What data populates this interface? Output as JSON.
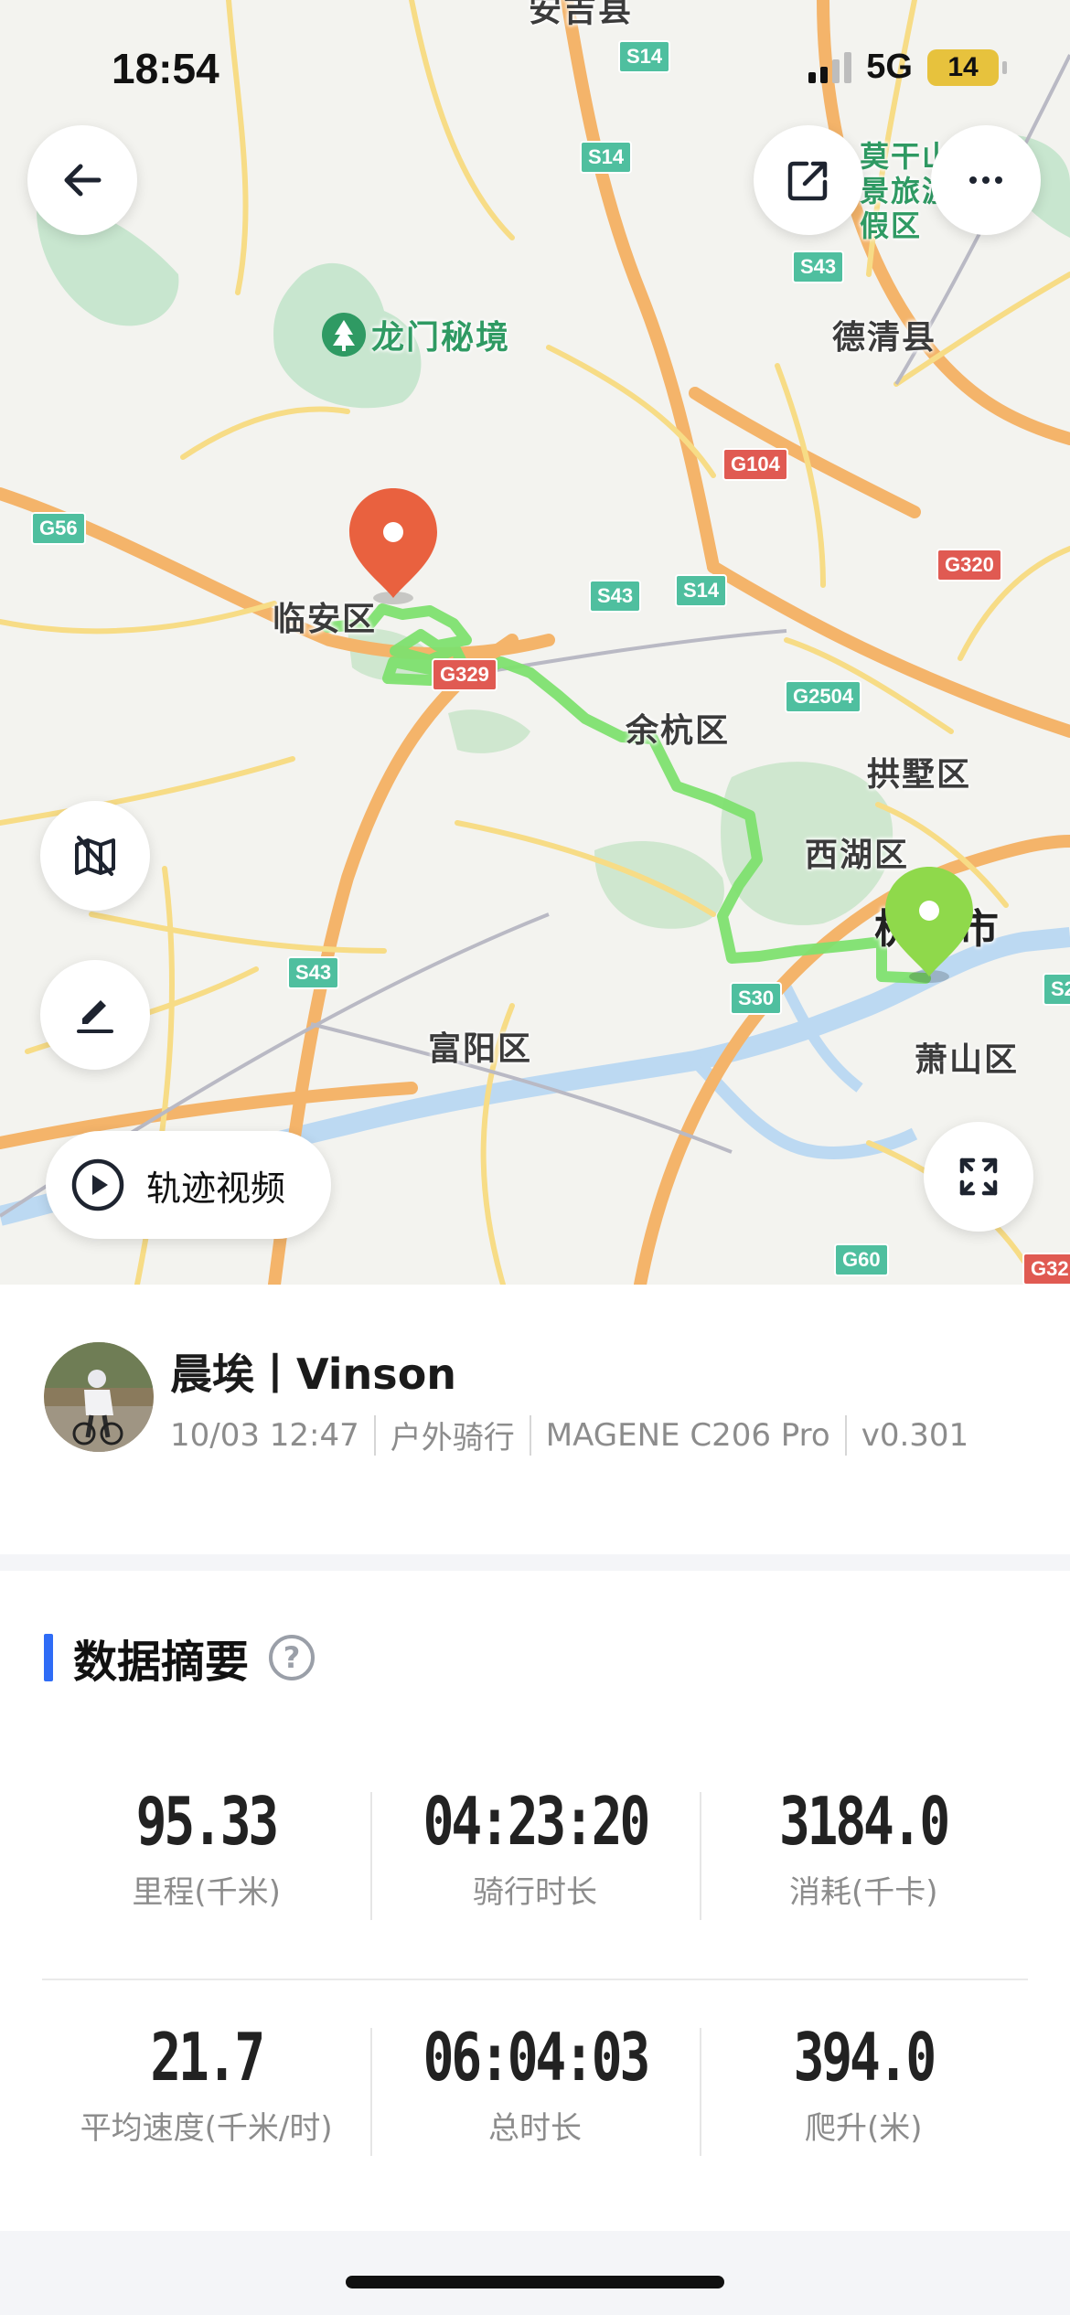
{
  "status_bar": {
    "time": "18:54",
    "network": "5G",
    "battery": "14"
  },
  "map": {
    "place_labels": [
      {
        "id": "top-cut",
        "text": "安吉县"
      },
      {
        "id": "longmen",
        "text": "龙门秘境"
      },
      {
        "id": "deqing",
        "text": "德清县"
      },
      {
        "id": "linan",
        "text": "临安区"
      },
      {
        "id": "yuhang",
        "text": "余杭区"
      },
      {
        "id": "gongshu",
        "text": "拱墅区"
      },
      {
        "id": "xihu",
        "text": "西湖区"
      },
      {
        "id": "city",
        "text": "杭州市"
      },
      {
        "id": "xiaoshan",
        "text": "萧山区"
      },
      {
        "id": "fuyang",
        "text": "富阳区"
      },
      {
        "id": "moganshan",
        "text": "莫干山风景旅游度假区"
      }
    ],
    "road_shields": [
      {
        "id": "s14a",
        "text": "S14"
      },
      {
        "id": "s14b",
        "text": "S14"
      },
      {
        "id": "s43a",
        "text": "S43"
      },
      {
        "id": "g104",
        "text": "G104"
      },
      {
        "id": "g56",
        "text": "G56"
      },
      {
        "id": "g320",
        "text": "G320"
      },
      {
        "id": "s43b",
        "text": "S43"
      },
      {
        "id": "s14c",
        "text": "S14"
      },
      {
        "id": "g329",
        "text": "G329"
      },
      {
        "id": "g2504",
        "text": "G2504"
      },
      {
        "id": "s43c",
        "text": "S43"
      },
      {
        "id": "s30",
        "text": "S30"
      },
      {
        "id": "g60",
        "text": "G60"
      },
      {
        "id": "g32",
        "text": "G32"
      },
      {
        "id": "s2",
        "text": "S2"
      }
    ],
    "track_video_label": "轨迹视频",
    "colors": {
      "track": "#7ee06f",
      "start_pin": "#e9613f",
      "end_pin": "#8fd94b"
    }
  },
  "profile": {
    "name": "晨埃丨Vinson",
    "date": "10/03 12:47",
    "sport": "户外骑行",
    "device": "MAGENE C206 Pro",
    "version": "v0.301"
  },
  "summary": {
    "title": "数据摘要",
    "help": "?",
    "stats": [
      {
        "value": "95.33",
        "label": "里程(千米)"
      },
      {
        "value": "04:23:20",
        "label": "骑行时长"
      },
      {
        "value": "3184.0",
        "label": "消耗(千卡)"
      },
      {
        "value": "21.7",
        "label": "平均速度(千米/时)"
      },
      {
        "value": "06:04:03",
        "label": "总时长"
      },
      {
        "value": "394.0",
        "label": "爬升(米)"
      }
    ]
  }
}
